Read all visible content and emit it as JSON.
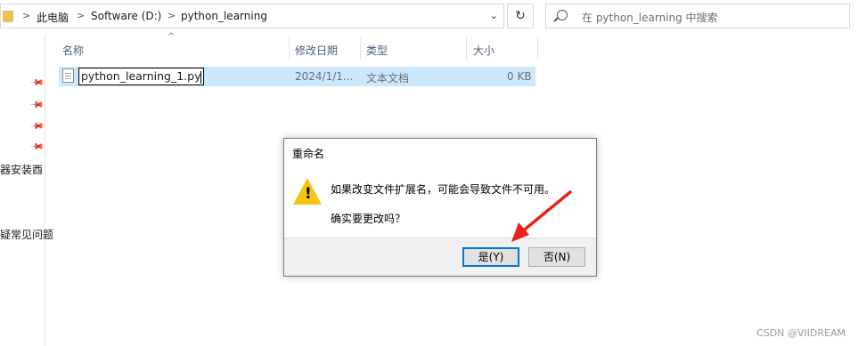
{
  "address_bar": {
    "crumbs": [
      "此电脑",
      "Software (D:)",
      "python_learning"
    ],
    "separator": ">",
    "dropdown_glyph": "⌄"
  },
  "refresh_glyph": "↻",
  "search": {
    "placeholder": "在 python_learning 中搜索",
    "icon": "search-icon"
  },
  "nav": {
    "pins": [
      "pin-icon",
      "pin-icon",
      "pin-icon",
      "pin-icon"
    ],
    "items": [
      "器安装酉",
      "疑常见问题"
    ]
  },
  "columns": {
    "name": "名称",
    "modified": "修改日期",
    "type": "类型",
    "size": "大小",
    "sort_glyph": "^"
  },
  "file": {
    "name": "python_learning_1.py",
    "modified": "2024/1/1...",
    "type": "文本文档",
    "size": "0 KB"
  },
  "dialog": {
    "title": "重命名",
    "icon": "warning-icon",
    "warning_mark": "!",
    "message_line1": "如果改变文件扩展名，可能会导致文件不可用。",
    "message_line2": "确实要更改吗？",
    "yes_label": "是(Y)",
    "no_label": "否(N)"
  },
  "annotation": {
    "arrow_color": "#e8221b"
  },
  "watermark": "CSDN @VIIDREAM",
  "colors": {
    "selection": "#cce8ff",
    "accent": "#0078d7",
    "warning": "#f3c60f"
  }
}
